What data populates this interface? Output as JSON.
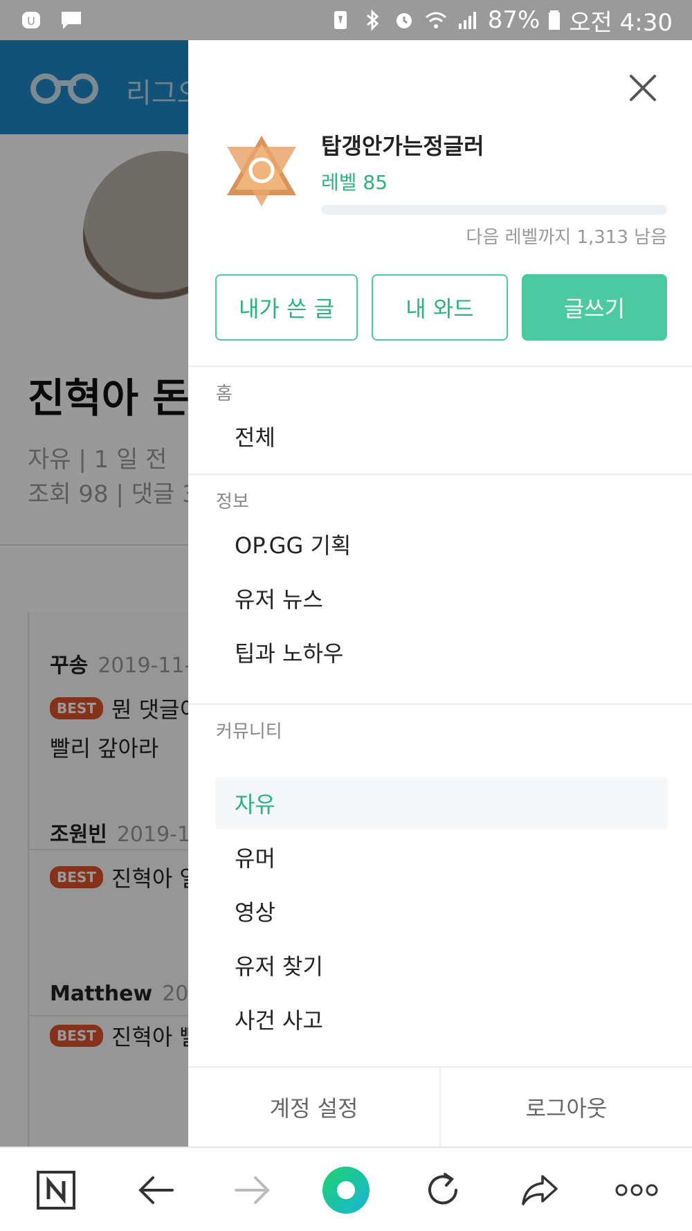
{
  "status_bar": {
    "battery": "87%",
    "time": "오전 4:30",
    "icons": [
      "app-notification-icon",
      "message-icon",
      "battery-saver-icon",
      "bluetooth-icon",
      "alarm-icon",
      "wifi-icon",
      "signal-icon",
      "battery-icon"
    ]
  },
  "background_page": {
    "brand": "리그오",
    "title": "진혁아 돈",
    "meta_line1": "자유 | 1 일 전",
    "meta_line2": "조회 98 | 댓글 3",
    "comments": [
      {
        "author": "꾸송",
        "date": "2019-11-",
        "badge": "BEST",
        "text": "뭔 댓글이",
        "text2": "빨리 갚아라"
      },
      {
        "author": "조원빈",
        "date": "2019-1",
        "badge": "BEST",
        "text": "진혁아 얼",
        "text2": ""
      },
      {
        "author": "Matthew",
        "date": "201",
        "badge": "BEST",
        "text": "진혁아 빨",
        "text2": ""
      }
    ]
  },
  "drawer": {
    "profile": {
      "username": "탑갱안가는정글러",
      "level_label": "레벨 85",
      "progress": 0.0,
      "next_level_text": "다음 레벨까지 1,313 남음",
      "badge_icon": "level-badge-icon"
    },
    "buttons": {
      "my_posts": "내가 쓴 글",
      "my_ward": "내 와드",
      "write": "글쓰기"
    },
    "sections": [
      {
        "label": "홈",
        "items": [
          "전체"
        ]
      },
      {
        "label": "정보",
        "items": [
          "OP.GG 기획",
          "유저 뉴스",
          "팁과 노하우"
        ]
      },
      {
        "label": "커뮤니티",
        "items": [
          "자유",
          "유머",
          "영상",
          "유저 찾기",
          "사건 사고"
        ]
      }
    ],
    "active_item": "자유",
    "footer": {
      "account_settings": "계정 설정",
      "logout": "로그아웃"
    }
  },
  "bottom_bar": {
    "items": [
      "naver-home-icon",
      "back-arrow-icon",
      "forward-arrow-icon",
      "green-dot-icon",
      "refresh-icon",
      "share-icon",
      "more-icon"
    ]
  },
  "colors": {
    "accent": "#2bb37e",
    "accent_button": "#4cc9a0",
    "header_blue": "#1e88c9",
    "best_badge": "#e0522b"
  }
}
